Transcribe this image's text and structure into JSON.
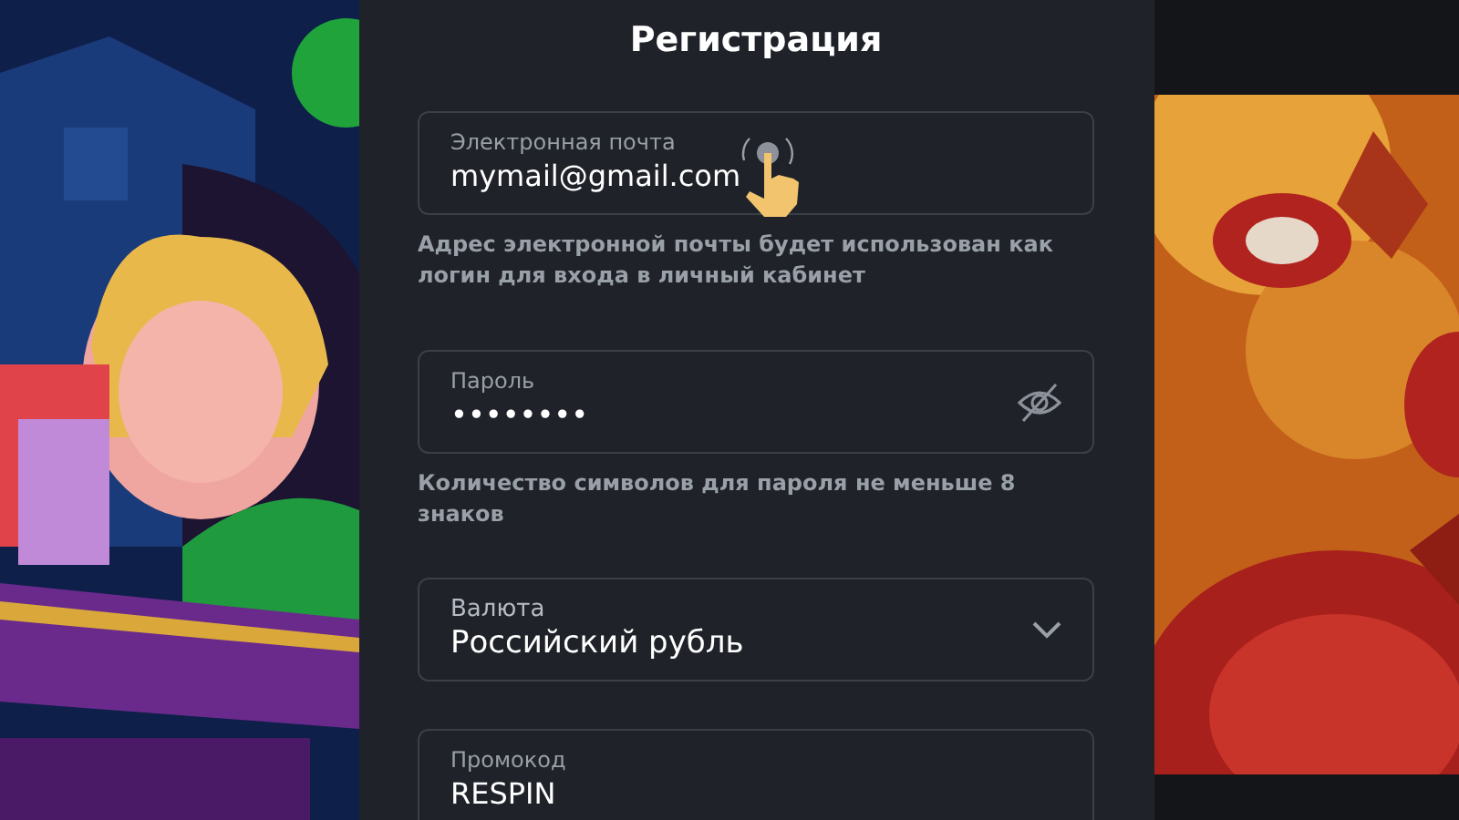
{
  "title": "Регистрация",
  "fields": [
    {
      "kind": "text",
      "label": "Электронная почта",
      "value": "mymail@gmail.com",
      "hint": "Адрес электронной почты будет использован как логин для входа в личный кабинет"
    },
    {
      "kind": "password",
      "label": "Пароль",
      "value": "••••••••",
      "hint": "Количество символов для пароля не меньше 8 знаков"
    },
    {
      "kind": "select",
      "label": "Валюта",
      "value": "Российский рубль"
    },
    {
      "kind": "text",
      "label": "Промокод",
      "value": "RESPIN"
    }
  ]
}
